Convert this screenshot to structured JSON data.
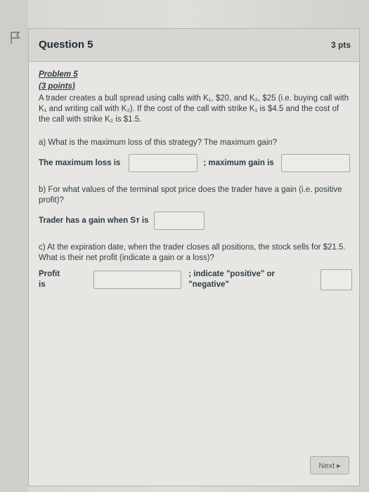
{
  "question": {
    "title": "Question 5",
    "points": "3 pts",
    "problem_label": "Problem 5",
    "points_label": "(3 points)",
    "intro": "A trader creates a bull spread using calls with K₁, $20, and K₂, $25 (i.e. buying call with K₁ and writing call with K₂). If the cost of the call with strike K₁ is $4.5 and the cost of the call with strike K₂ is $1.5.",
    "part_a": "a) What is the maximum loss of this strategy? The maximum gain?",
    "max_loss_label": "The maximum loss is",
    "max_gain_label": "; maximum gain is",
    "part_b": "b) For what values of the terminal spot price does the trader have a gain (i.e. positive profit)?",
    "gain_when_label": "Trader has a gain when Sᴛ is",
    "part_c": "c) At the expiration date, when the trader closes all positions, the stock sells for $21.5. What is their net profit (indicate a gain or a loss)?",
    "profit_label": "Profit is",
    "indicate_label": "; indicate \"positive\" or \"negative\"",
    "inputs": {
      "max_loss": "",
      "max_gain": "",
      "gain_when": "",
      "profit": "",
      "sign": ""
    }
  },
  "next_button": "Next ▸"
}
